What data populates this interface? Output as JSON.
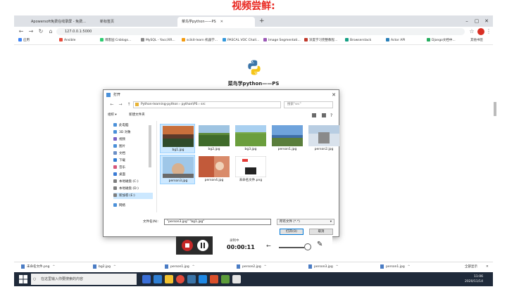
{
  "caption": "视频尝鲜:",
  "browser": {
    "tabs": [
      {
        "label": "Apowersoft免费在线录屏 - 免费..."
      },
      {
        "label": "新标签页"
      },
      {
        "label": "菜鸟学python——PS",
        "active": true
      }
    ],
    "url": "127.0.0.1:5000",
    "bookmarks": [
      {
        "label": "应用",
        "color": "#3b82f6"
      },
      {
        "label": "Ansible",
        "color": "#e74c3c"
      },
      {
        "label": "博客园 Cnblogs...",
        "color": "#2ecc71"
      },
      {
        "label": "MySQL - Yacc/XR...",
        "color": "#888888"
      },
      {
        "label": "scikit-learn 机器学...",
        "color": "#f39c12"
      },
      {
        "label": "PASCAL VOC Chall...",
        "color": "#3498db"
      },
      {
        "label": "Image Segmentati...",
        "color": "#9b59b6"
      },
      {
        "label": "深度学习完整教程...",
        "color": "#c0392b"
      },
      {
        "label": "Browserstack",
        "color": "#16a085"
      },
      {
        "label": "Actor API",
        "color": "#2980b9"
      },
      {
        "label": "Django文档中...",
        "color": "#27ae60"
      }
    ],
    "bookmarks_right": "其他书签"
  },
  "page": {
    "title": "菜鸟学python——PS"
  },
  "dialog": {
    "title": "打开",
    "path": "Python-learning-python › python\\PS › src",
    "search_placeholder": "搜索\"src\"",
    "toolbar": {
      "organize": "组织 ▾",
      "new_folder": "新建文件夹"
    },
    "sidebar": [
      {
        "label": "此电脑",
        "color": "#4a90d9"
      },
      {
        "label": "3D 对象",
        "color": "#4a90d9"
      },
      {
        "label": "视频",
        "color": "#7b61c4"
      },
      {
        "label": "图片",
        "color": "#4a90d9"
      },
      {
        "label": "文档",
        "color": "#6b8fc6"
      },
      {
        "label": "下载",
        "color": "#2f7bd1"
      },
      {
        "label": "音乐",
        "color": "#d6567a"
      },
      {
        "label": "桌面",
        "color": "#3a7bd5"
      },
      {
        "label": "本地磁盘 (C:)",
        "color": "#7d7d7d"
      },
      {
        "label": "本地磁盘 (D:)",
        "color": "#7d7d7d"
      },
      {
        "label": "新加卷 (E:)",
        "color": "#7d7d7d",
        "selected": true
      },
      {
        "label": "网络",
        "color": "#4a90d9"
      }
    ],
    "files": [
      {
        "name": "bg1.jpg",
        "selected": true
      },
      {
        "name": "bg2.jpg"
      },
      {
        "name": "bg3.jpg"
      },
      {
        "name": "person1.jpg"
      },
      {
        "name": "person2.jpg"
      },
      {
        "name": "person3.jpg",
        "selected": true
      },
      {
        "name": "person4.jpg"
      },
      {
        "name": "未命名文件.png"
      }
    ],
    "filename_label": "文件名(N):",
    "filename_value": "\"person3.jpg\" \"bg1.jpg\"",
    "filetype": "所有文件 (*.*)",
    "open_label": "打开(O)",
    "cancel_label": "取消"
  },
  "recorder": {
    "label": "录制中",
    "time": "00:00:11"
  },
  "downloads": [
    {
      "name": "未命名文件.png"
    },
    {
      "name": "bg2.jpg"
    },
    {
      "name": "person1.jpg"
    },
    {
      "name": "person2.jpg"
    },
    {
      "name": "person3.jpg"
    },
    {
      "name": "person1.jpg"
    }
  ],
  "downloads_showall": "全部显示",
  "taskbar": {
    "search_placeholder": "在这里输入你要搜索的内容",
    "time": "11:06",
    "date": "2020/11/14"
  }
}
